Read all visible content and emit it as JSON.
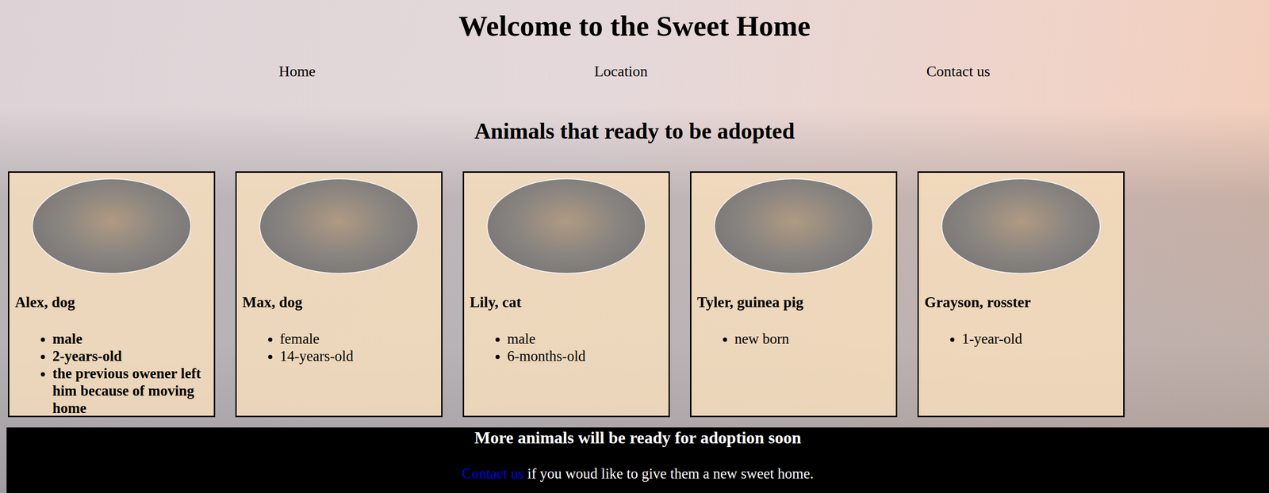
{
  "page": {
    "title": "Welcome to the Sweet Home"
  },
  "nav": {
    "items": [
      {
        "label": "Home"
      },
      {
        "label": "Location"
      },
      {
        "label": "Contact us"
      }
    ]
  },
  "section": {
    "title": "Animals that ready to be adopted"
  },
  "animals": [
    {
      "name": "Alex, dog",
      "bold": true,
      "facts": [
        "male",
        "2-years-old",
        "the previous owener left him because of moving home"
      ]
    },
    {
      "name": "Max, dog",
      "bold": false,
      "facts": [
        "female",
        "14-years-old"
      ]
    },
    {
      "name": "Lily, cat",
      "bold": false,
      "facts": [
        "male",
        "6-months-old"
      ]
    },
    {
      "name": "Tyler, guinea pig",
      "bold": false,
      "facts": [
        "new born"
      ]
    },
    {
      "name": "Grayson, rosster",
      "bold": false,
      "facts": [
        "1-year-old"
      ]
    }
  ],
  "footer": {
    "title": "More animals will be ready for adoption soon",
    "link": "Contact us",
    "text": " if you woud like to give them a new sweet home."
  }
}
